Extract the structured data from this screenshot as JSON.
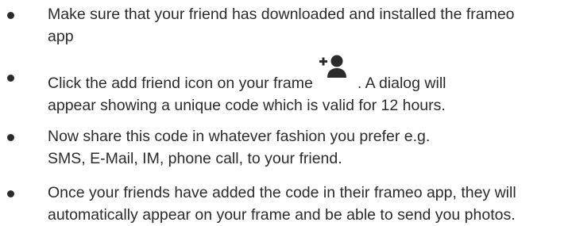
{
  "instructions": [
    {
      "lines": [
        "Make sure that your friend has downloaded and installed the frameo",
        "app"
      ]
    },
    {
      "line1_before_icon": "Click the add friend icon on your frame",
      "icon": "add-friend-icon",
      "line1_after_icon": ". A dialog will",
      "line2": "appear showing a unique code which is valid for 12 hours."
    },
    {
      "lines": [
        "Now share this code in whatever fashion you prefer e.g.",
        "SMS, E-Mail, IM, phone call, to your friend."
      ]
    },
    {
      "lines": [
        "Once your friends have added the code in their frameo  app, they will",
        "automatically appear on your frame and be able to send you photos."
      ]
    }
  ]
}
